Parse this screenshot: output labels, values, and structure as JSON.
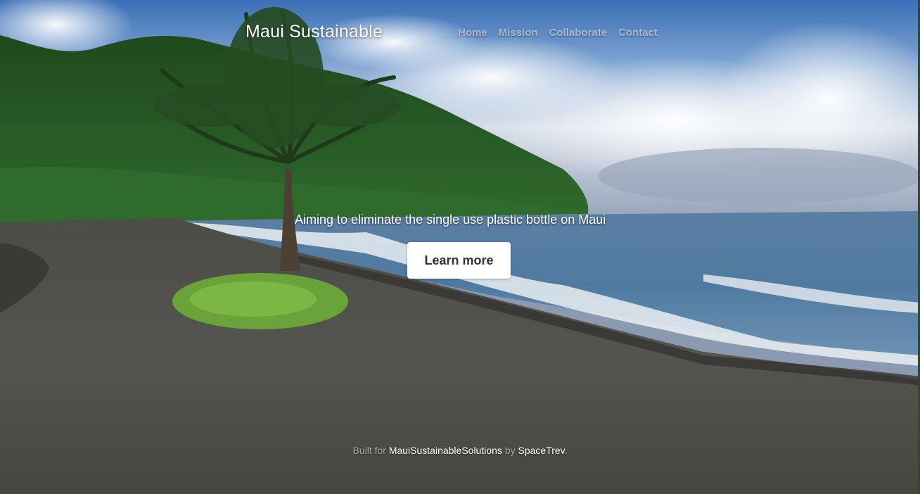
{
  "header": {
    "brand": "Maui Sustainable",
    "nav": [
      "Home",
      "Mission",
      "Collaborate",
      "Contact"
    ]
  },
  "hero": {
    "tagline": "Aiming to eliminate the single use plastic bottle on Maui",
    "cta_label": "Learn more"
  },
  "footer": {
    "prefix": "Built for",
    "org_link": "MauiSustainableSolutions",
    "by": "by",
    "author_link": "SpaceTrev",
    "suffix": "."
  },
  "colors": {
    "text": "#ffffff",
    "button_bg": "#ffffff",
    "button_text": "#333333"
  }
}
